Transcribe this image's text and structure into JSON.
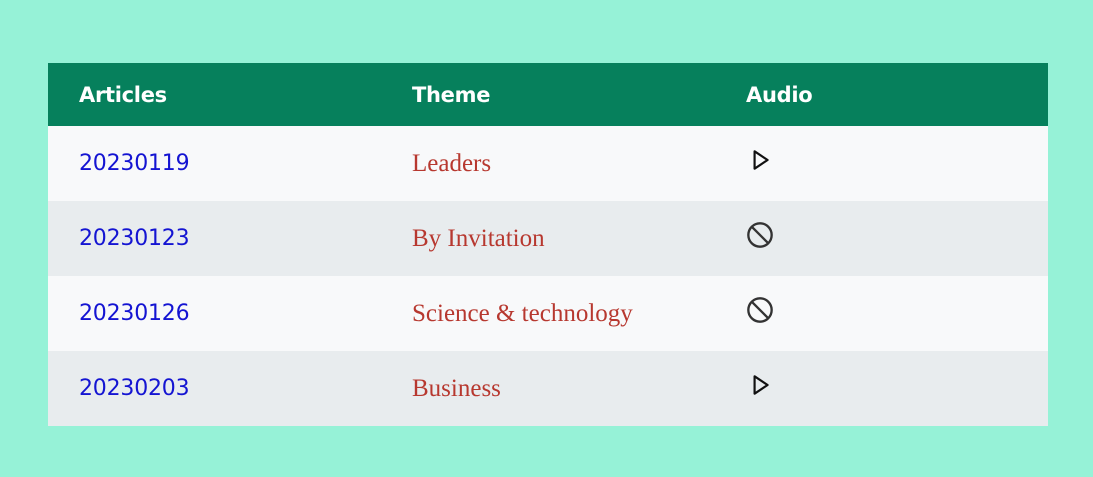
{
  "table": {
    "headers": {
      "articles": "Articles",
      "theme": "Theme",
      "audio": "Audio"
    },
    "rows": [
      {
        "article": "20230119",
        "theme": "Leaders",
        "audio": "play-icon"
      },
      {
        "article": "20230123",
        "theme": "By Invitation",
        "audio": "not-available-icon"
      },
      {
        "article": "20230126",
        "theme": "Science & technology",
        "audio": "not-available-icon"
      },
      {
        "article": "20230203",
        "theme": "Business",
        "audio": "play-icon"
      }
    ]
  },
  "colors": {
    "page_background": "#96f2d7",
    "header_background": "#06805c",
    "header_text": "#ffffff",
    "row_light": "#f8f9fa",
    "row_dark": "#e8ecee",
    "article_link": "#1414d2",
    "theme_text": "#b7382f"
  }
}
